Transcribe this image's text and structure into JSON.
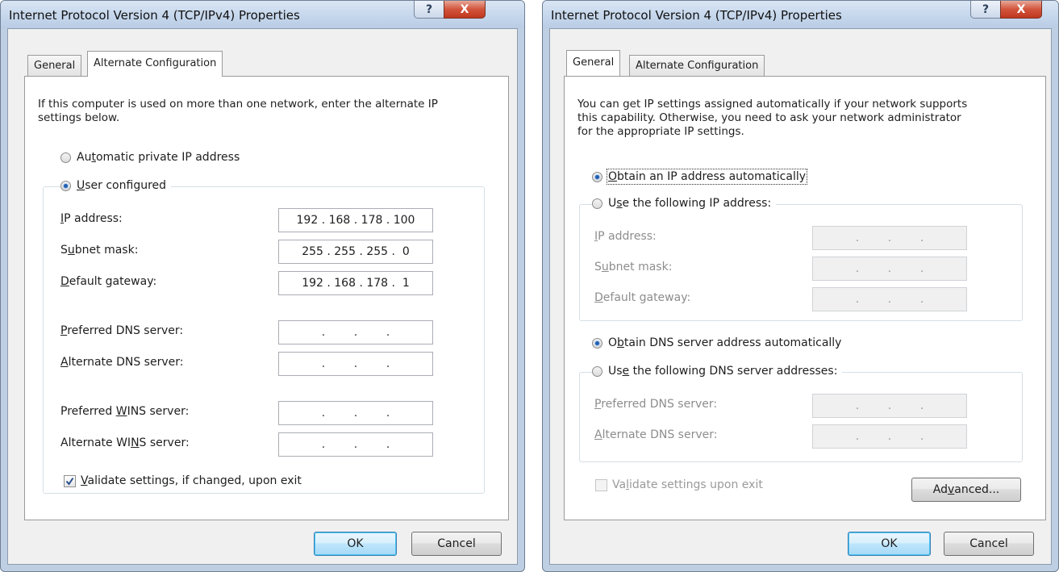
{
  "dialogs": {
    "left": {
      "title": "Internet Protocol Version 4 (TCP/IPv4) Properties",
      "help_glyph": "?",
      "close_glyph": "X",
      "tabs": [
        "General",
        "Alternate Configuration"
      ],
      "active_tab": "Alternate Configuration",
      "intro": "If this computer is used on more than one network, enter the alternate IP\nsettings below.",
      "radio_auto": {
        "pre": "Au",
        "key": "t",
        "post": "omatic private IP address",
        "checked": false
      },
      "radio_user": {
        "pre": "",
        "key": "U",
        "post": "ser configured",
        "checked": true
      },
      "fields": {
        "ip": {
          "pre": "",
          "key": "I",
          "post": "P address:",
          "value": "192 . 168 . 178 . 100"
        },
        "subnet": {
          "pre": "S",
          "key": "u",
          "post": "bnet mask:",
          "value": "255 . 255 . 255 .  0"
        },
        "gateway": {
          "pre": "",
          "key": "D",
          "post": "efault gateway:",
          "value": "192 . 168 . 178 .  1"
        },
        "pref_dns": {
          "pre": "",
          "key": "P",
          "post": "referred DNS server:",
          "value": ".        .        ."
        },
        "alt_dns": {
          "pre": "",
          "key": "A",
          "post": "lternate DNS server:",
          "value": ".        .        ."
        },
        "pref_wins": {
          "pre": "Preferred ",
          "key": "W",
          "post": "INS server:",
          "value": ".        .        ."
        },
        "alt_wins": {
          "pre": "Alternate WI",
          "key": "N",
          "post": "S server:",
          "value": ".        .        ."
        }
      },
      "validate": {
        "pre": "",
        "key": "V",
        "post": "alidate settings, if changed, upon exit",
        "checked": true
      },
      "ok": "OK",
      "cancel": "Cancel"
    },
    "right": {
      "title": "Internet Protocol Version 4 (TCP/IPv4) Properties",
      "help_glyph": "?",
      "close_glyph": "X",
      "tabs": [
        "General",
        "Alternate Configuration"
      ],
      "active_tab": "General",
      "intro": "You can get IP settings assigned automatically if your network supports\nthis capability. Otherwise, you need to ask your network administrator\nfor the appropriate IP settings.",
      "radio_obtain_ip": {
        "pre": "",
        "key": "O",
        "post": "btain an IP address automatically",
        "checked": true
      },
      "radio_use_ip": {
        "pre": "U",
        "key": "s",
        "post": "e the following IP address:",
        "checked": false
      },
      "fields": {
        "ip": {
          "pre": "",
          "key": "I",
          "post": "P address:",
          "value": ".        .        ."
        },
        "subnet": {
          "pre": "S",
          "key": "u",
          "post": "bnet mask:",
          "value": ".        .        ."
        },
        "gateway": {
          "pre": "",
          "key": "D",
          "post": "efault gateway:",
          "value": ".        .        ."
        },
        "pref_dns": {
          "pre": "",
          "key": "P",
          "post": "referred DNS server:",
          "value": ".        .        ."
        },
        "alt_dns": {
          "pre": "",
          "key": "A",
          "post": "lternate DNS server:",
          "value": ".        .        ."
        }
      },
      "radio_obtain_dns": {
        "pre": "O",
        "key": "b",
        "post": "tain DNS server address automatically",
        "checked": true
      },
      "radio_use_dns": {
        "pre": "Us",
        "key": "e",
        "post": " the following DNS server addresses:",
        "checked": false
      },
      "validate": {
        "pre": "Va",
        "key": "l",
        "post": "idate settings upon exit",
        "checked": false
      },
      "advanced": {
        "pre": "Ad",
        "key": "v",
        "post": "anced..."
      },
      "ok": "OK",
      "cancel": "Cancel"
    }
  }
}
